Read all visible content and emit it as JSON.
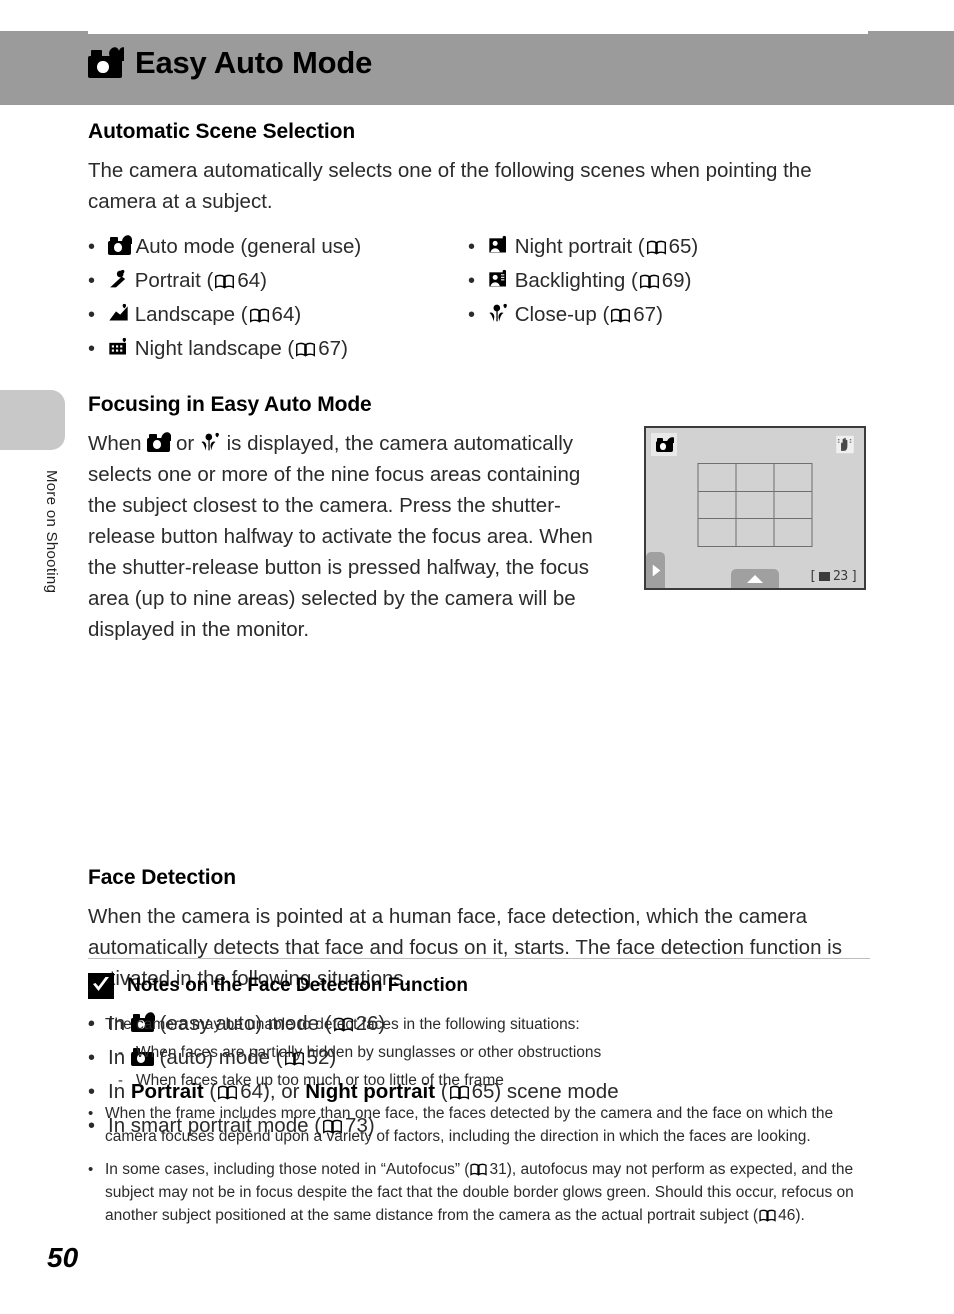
{
  "page": {
    "number": "50",
    "chapter_tab_label": "More on Shooting"
  },
  "header": {
    "title": "Easy Auto Mode",
    "icon": "easy-auto-camera-heart-icon"
  },
  "sections": {
    "scene_selection": {
      "heading": "Automatic Scene Selection",
      "intro": "The camera automatically selects one of the following scenes when pointing the camera at a subject.",
      "left_items": [
        {
          "icon": "easy-auto-camera-heart-icon",
          "label": "Auto mode (general use)",
          "page": ""
        },
        {
          "icon": "portrait-icon",
          "label": "Portrait",
          "page": "64"
        },
        {
          "icon": "landscape-icon",
          "label": "Landscape",
          "page": "64"
        },
        {
          "icon": "night-landscape-icon",
          "label": "Night landscape",
          "page": "67"
        }
      ],
      "right_items": [
        {
          "icon": "night-portrait-icon",
          "label": "Night portrait",
          "page": "65"
        },
        {
          "icon": "backlighting-icon",
          "label": "Backlighting",
          "page": "69"
        },
        {
          "icon": "close-up-icon",
          "label": "Close-up",
          "page": "67"
        }
      ]
    },
    "focusing": {
      "heading": "Focusing in Easy Auto Mode",
      "text_before": "When",
      "text_mid": "or",
      "text_after": "is displayed, the camera automatically selects one or more of the nine focus areas containing the subject closest to the camera. Press the shutter-release button halfway to activate the focus area. When the shutter-release button is pressed halfway, the focus area (up to nine areas) selected by the camera will be displayed in the monitor."
    },
    "face_detection": {
      "heading": "Face Detection",
      "intro": "When the camera is pointed at a human face, face detection, which the camera automatically detects that face and focus on it, starts. The face detection function is activated in the following situations.",
      "items": [
        {
          "prefix": "In",
          "icon": "easy-auto-camera-heart-icon",
          "mid": "(easy auto) mode",
          "page": "26",
          "suffix": ""
        },
        {
          "prefix": "In",
          "icon": "auto-camera-icon",
          "mid": "(auto) mode",
          "page": "52",
          "suffix": ""
        },
        {
          "prefix": "In",
          "icon": "",
          "bold1": "Portrait",
          "page1": "64",
          "joiner": ", or",
          "bold2": "Night portrait",
          "page2": "65",
          "suffix": "scene mode"
        },
        {
          "prefix": "In smart portrait mode",
          "icon": "",
          "mid": "",
          "page": "73",
          "suffix": ""
        }
      ]
    }
  },
  "monitor": {
    "cam_badge_icon": "easy-auto-camera-heart-icon",
    "vr_icon": "vibration-reduction-hand-icon",
    "play_icon": "play-arrow-icon",
    "up_icon": "up-triangle-icon",
    "focus_area_count": 9,
    "frame_counter": "23",
    "counter_open": "[",
    "counter_close": "]"
  },
  "notes": {
    "icon": "check-mark-icon",
    "title": "Notes on the Face Detection Function",
    "items": [
      {
        "text": "The camera may be unable to detect faces in the following situations:",
        "sub": [
          "When faces are partially hidden by sunglasses or other obstructions",
          "When faces take up too much or too little of the frame"
        ]
      },
      {
        "text": "When the frame includes more than one face, the faces detected by the camera and the face on which the camera focuses depend upon a variety of factors, including the direction in which the faces are looking.",
        "sub": []
      },
      {
        "text_a": "In some cases, including those noted in “Autofocus” (",
        "page_a": "31",
        "text_b": "), autofocus may not perform as expected, and the subject may not be in focus despite the fact that the double border glows green. Should this occur, refocus on another subject positioned at the same distance from the camera as the actual portrait subject (",
        "page_b": "46",
        "text_c": ").",
        "sub": []
      }
    ]
  },
  "colors": {
    "header_bar": "#9b9b9b",
    "side_tab": "#c8c8c8",
    "monitor_bg": "#d2d2d2",
    "monitor_border": "#3b3b3b",
    "text": "#2b2b2b"
  }
}
